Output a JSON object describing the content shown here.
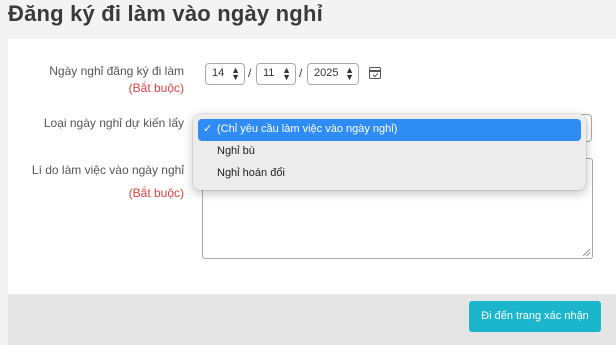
{
  "page": {
    "title": "Đăng ký đi làm vào ngày nghỉ"
  },
  "form": {
    "date_label": "Ngày nghỉ đăng ký đi làm",
    "date_required": "(Bắt buộc)",
    "day": "14",
    "month": "11",
    "year": "2025",
    "date_separator": "/",
    "type_label": "Loại ngày nghỉ dự kiến lấy",
    "reason_label": "Lí do làm việc vào ngày nghỉ",
    "reason_required": "(Bắt buộc)",
    "reason_value": ""
  },
  "dropdown": {
    "options": [
      {
        "label": "(Chỉ yêu cầu làm việc vào ngày nghỉ)",
        "selected": true
      },
      {
        "label": "Nghỉ bù",
        "selected": false
      },
      {
        "label": "Nghỉ hoán đổi",
        "selected": false
      }
    ],
    "check_mark": "✓"
  },
  "footer": {
    "confirm_button": "Đi đến trang xác nhận"
  },
  "colors": {
    "accent": "#1bb5cc",
    "required": "#e04040",
    "dropdown_highlight": "#2f8cf5"
  },
  "icons": {
    "calendar": "calendar-icon",
    "stepper": "up-down-arrows"
  }
}
